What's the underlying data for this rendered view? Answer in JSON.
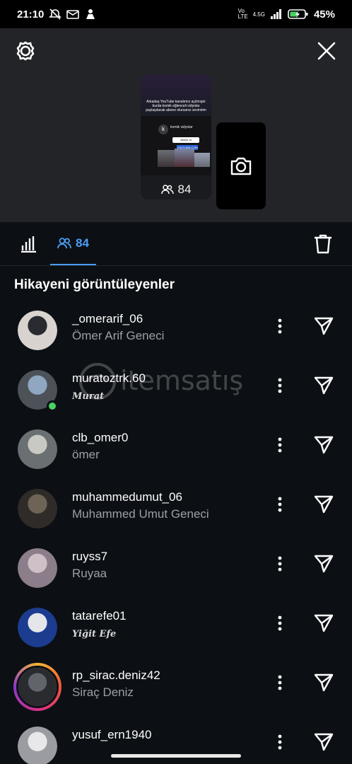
{
  "status_bar": {
    "time": "21:10",
    "network": "4.5G",
    "volte": "Vo LTE",
    "battery": "45%"
  },
  "story": {
    "thumbnail_text": "Arkadaş YouTube kanalımız açılmıştır burda komik eğlenceli vidyolar paylaşılacak abone olursanız sevinirim",
    "thumbnail_channel": "komik vidyolar",
    "thumbnail_avatar_letter": "k",
    "thumbnail_subscribe": "Abone ol",
    "thumbnail_link": "YOUTUBE.COM",
    "viewer_count": "84"
  },
  "tabs": {
    "viewers_count": "84"
  },
  "section_title": "Hikayeni görüntüleyenler",
  "watermark": "itemsatış",
  "viewers": [
    {
      "username": "_omerarif_06",
      "full_name": "Ömer Arif Geneci",
      "script": false,
      "online": false,
      "ring": false,
      "avatar_colors": [
        "#2a2b30",
        "#d8d3cf"
      ]
    },
    {
      "username": "muratoztrk.60",
      "full_name": "Murat",
      "script": true,
      "online": true,
      "ring": false,
      "avatar_colors": [
        "#8fa7c0",
        "#4d5259"
      ]
    },
    {
      "username": "clb_omer0",
      "full_name": "ömer",
      "script": false,
      "online": false,
      "ring": false,
      "avatar_colors": [
        "#c7c9c2",
        "#6a6f72"
      ]
    },
    {
      "username": "muhammedumut_06",
      "full_name": "Muhammed Umut Geneci",
      "script": false,
      "online": false,
      "ring": false,
      "avatar_colors": [
        "#6e6456",
        "#2f2b28"
      ]
    },
    {
      "username": "ruyss7",
      "full_name": "Ruyaa",
      "script": false,
      "online": false,
      "ring": false,
      "avatar_colors": [
        "#cfc0c7",
        "#8b7d8a"
      ]
    },
    {
      "username": "tatarefe01",
      "full_name": "Yiğit Efe",
      "script": true,
      "online": false,
      "ring": false,
      "avatar_colors": [
        "#e4e6ea",
        "#1b3c8f"
      ]
    },
    {
      "username": "rp_sirac.deniz42",
      "full_name": "Siraç Deniz",
      "script": false,
      "online": false,
      "ring": true,
      "avatar_colors": [
        "#61656b",
        "#2a2b2f"
      ]
    },
    {
      "username": "yusuf_ern1940",
      "full_name": "",
      "script": false,
      "online": false,
      "ring": false,
      "avatar_colors": [
        "#e8e8ea",
        "#9a9ca1"
      ]
    }
  ]
}
